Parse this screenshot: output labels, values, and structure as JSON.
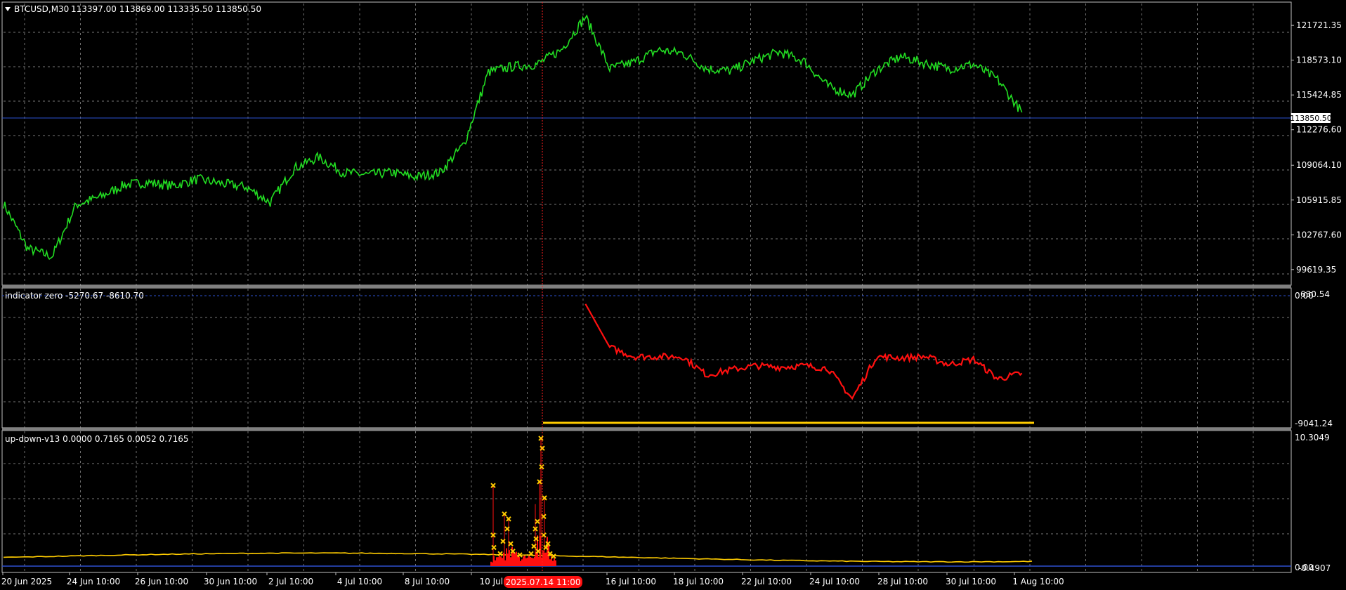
{
  "colors": {
    "background": "#000000",
    "grid": "#a0a0a0",
    "frame": "#c0c0c0",
    "text": "#ffffff",
    "price": "#22dd22",
    "indicator_zero": "#ff1010",
    "updown_line": "#ffcc00",
    "updown_hist": "#ff1010",
    "updown_marker": "#ffcc00",
    "blue_level": "#2d4fd0",
    "crosshair": "#ff2020",
    "time_highlight": "#ff1010"
  },
  "icons": {
    "menu": "triangle-down-icon",
    "marker": "x-icon"
  },
  "main_panel": {
    "title": "BTCUSD,M30",
    "ohlc": "113397.00 113869.00 113335.50 113850.50",
    "y_labels": [
      "121721.35",
      "118573.10",
      "115424.85",
      "112276.60",
      "109064.10",
      "105915.85",
      "102767.60",
      "99619.35"
    ],
    "current_price_label": "113850.50"
  },
  "indicator_panel": {
    "title": "indicator zero -5270.67 -8610.70",
    "y_top_label": "0.00",
    "y_top_label2": "630.54",
    "y_bottom_label": "-9041.24"
  },
  "updown_panel": {
    "title": "up-down-v13 0.0000 0.7165 0.0052 0.7165",
    "y_top_label": "10.3049",
    "y_bottom_label": "0.00",
    "y_bottom_label2": "-0.4907"
  },
  "time_axis": {
    "labels": [
      "20 Jun 2025",
      "24 Jun 10:00",
      "26 Jun 10:00",
      "30 Jun 10:00",
      "2 Jul 10:00",
      "4 Jul 10:00",
      "8 Jul 10:00",
      "10 Jul 1",
      "16 Jul 10:00",
      "18 Jul 10:00",
      "22 Jul 10:00",
      "24 Jul 10:00",
      "28 Jul 10:00",
      "30 Jul 10:00",
      "1 Aug 10:00"
    ],
    "crosshair_time": "2025.07.14 11:00"
  },
  "chart_data": {
    "type": "line",
    "symbol": "BTCUSD",
    "timeframe": "M30",
    "price_series": {
      "x": [
        "2025-06-20",
        "2025-06-21",
        "2025-06-22",
        "2025-06-23",
        "2025-06-24",
        "2025-06-25",
        "2025-06-26",
        "2025-06-27",
        "2025-06-28",
        "2025-06-29",
        "2025-06-30",
        "2025-07-01",
        "2025-07-02",
        "2025-07-03",
        "2025-07-04",
        "2025-07-05",
        "2025-07-06",
        "2025-07-07",
        "2025-07-08",
        "2025-07-09",
        "2025-07-10",
        "2025-07-11",
        "2025-07-12",
        "2025-07-13",
        "2025-07-14",
        "2025-07-15",
        "2025-07-16",
        "2025-07-17",
        "2025-07-18",
        "2025-07-19",
        "2025-07-20",
        "2025-07-21",
        "2025-07-22",
        "2025-07-23",
        "2025-07-24",
        "2025-07-25",
        "2025-07-26",
        "2025-07-27",
        "2025-07-28",
        "2025-07-29",
        "2025-07-30",
        "2025-07-31",
        "2025-08-01"
      ],
      "y": [
        105600,
        101500,
        100800,
        105500,
        106200,
        107300,
        107500,
        107200,
        107800,
        107400,
        107100,
        105700,
        108800,
        109800,
        108400,
        108200,
        108400,
        108000,
        108400,
        111000,
        117500,
        118000,
        118200,
        119500,
        122500,
        117800,
        118400,
        119500,
        119200,
        117800,
        117600,
        118600,
        119300,
        118500,
        116200,
        115400,
        117700,
        118900,
        118300,
        117800,
        118200,
        116800,
        113850
      ]
    },
    "indicator_zero": {
      "x": [
        "2025-07-14",
        "2025-07-15",
        "2025-07-16",
        "2025-07-17",
        "2025-07-18",
        "2025-07-19",
        "2025-07-20",
        "2025-07-21",
        "2025-07-22",
        "2025-07-23",
        "2025-07-24",
        "2025-07-25",
        "2025-07-26",
        "2025-07-27",
        "2025-07-28",
        "2025-07-29",
        "2025-07-30",
        "2025-07-31",
        "2025-08-01"
      ],
      "y": [
        0,
        -3300,
        -4000,
        -4000,
        -4000,
        -5400,
        -5000,
        -4700,
        -4800,
        -4700,
        -4900,
        -7200,
        -4000,
        -4100,
        -4000,
        -4600,
        -4200,
        -5700,
        -5270
      ],
      "level": -8610.7
    },
    "updown_v13": {
      "line_level_approx": 0.7,
      "spike_values": [
        6.5,
        4.2,
        3.8,
        10.3,
        6.8
      ],
      "ylim": [
        -0.4907,
        10.3049
      ]
    },
    "ylim_main": [
      98400,
      123700
    ],
    "ylim_indicator": [
      -9041.24,
      630.54
    ]
  }
}
